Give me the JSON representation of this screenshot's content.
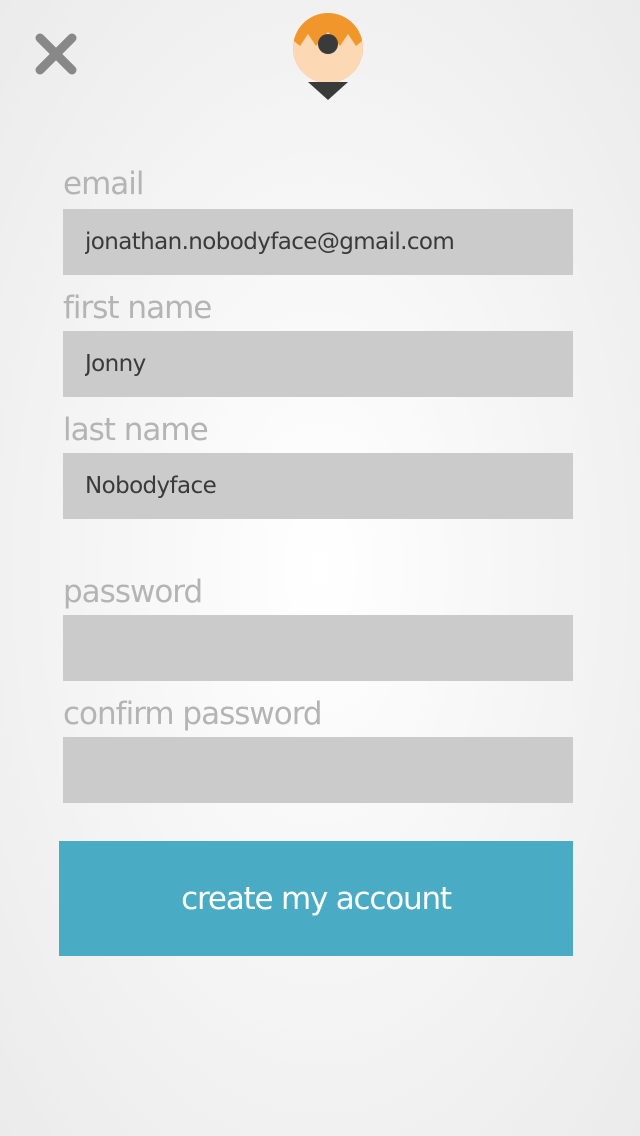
{
  "header": {
    "close_icon": "close-x-icon",
    "logo_icon": "map-pin-logo-icon"
  },
  "colors": {
    "background": "#f2f2f2",
    "label": "#b4b4b4",
    "input_background": "#cbcbcb",
    "input_text": "#3a3a3a",
    "button_background": "#4aabc5",
    "button_text": "#ffffff",
    "close_icon": "#888888",
    "logo_orange": "#f0962a",
    "logo_skin": "#fcd9b4",
    "logo_dark": "#3a3a3a"
  },
  "form": {
    "email": {
      "label": "email",
      "value": "jonathan.nobodyface@gmail.com"
    },
    "first_name": {
      "label": "first name",
      "value": "Jonny"
    },
    "last_name": {
      "label": "last name",
      "value": "Nobodyface"
    },
    "password": {
      "label": "password",
      "value": ""
    },
    "confirm_password": {
      "label": "confirm password",
      "value": ""
    }
  },
  "submit": {
    "label": "create my account"
  }
}
